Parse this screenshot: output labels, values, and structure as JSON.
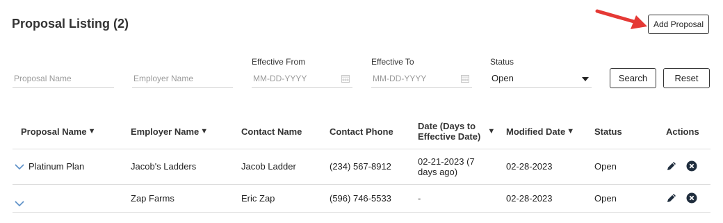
{
  "page": {
    "title": "Proposal Listing (2)",
    "add_button": "Add Proposal"
  },
  "filters": {
    "proposal_name": {
      "placeholder": "Proposal Name"
    },
    "employer_name": {
      "placeholder": "Employer Name"
    },
    "effective_from": {
      "label": "Effective From",
      "placeholder": "MM-DD-YYYY"
    },
    "effective_to": {
      "label": "Effective To",
      "placeholder": "MM-DD-YYYY"
    },
    "status": {
      "label": "Status",
      "value": "Open"
    },
    "search_button": "Search",
    "reset_button": "Reset"
  },
  "table": {
    "headers": {
      "proposal_name": "Proposal Name",
      "employer_name": "Employer Name",
      "contact_name": "Contact Name",
      "contact_phone": "Contact Phone",
      "date_line1": "Date (Days to",
      "date_line2": "Effective Date)",
      "modified_date": "Modified Date",
      "status": "Status",
      "actions": "Actions"
    },
    "sort_glyph": "▼",
    "rows": [
      {
        "proposal_name": "Platinum Plan",
        "employer_name": "Jacob's Ladders",
        "contact_name": "Jacob Ladder",
        "contact_phone": "(234) 567-8912",
        "date_line1": "02-21-2023 (7",
        "date_line2": "days ago)",
        "modified_date": "02-28-2023",
        "status": "Open"
      },
      {
        "proposal_name": "",
        "employer_name": "Zap Farms",
        "contact_name": "Eric Zap",
        "contact_phone": "(596) 746-5533",
        "date_line1": "-",
        "date_line2": "",
        "modified_date": "02-28-2023",
        "status": "Open"
      }
    ]
  },
  "icons": {
    "expand": "chevron-down-icon",
    "edit": "pencil-icon",
    "delete": "close-circle-icon",
    "calendar": "calendar-icon",
    "dropdown": "caret-down-icon",
    "annotation": "red-arrow-icon"
  },
  "colors": {
    "expand_chevron": "#5b8fc7",
    "action_icons": "#1f2d3d",
    "annotation_arrow": "#e53935"
  }
}
